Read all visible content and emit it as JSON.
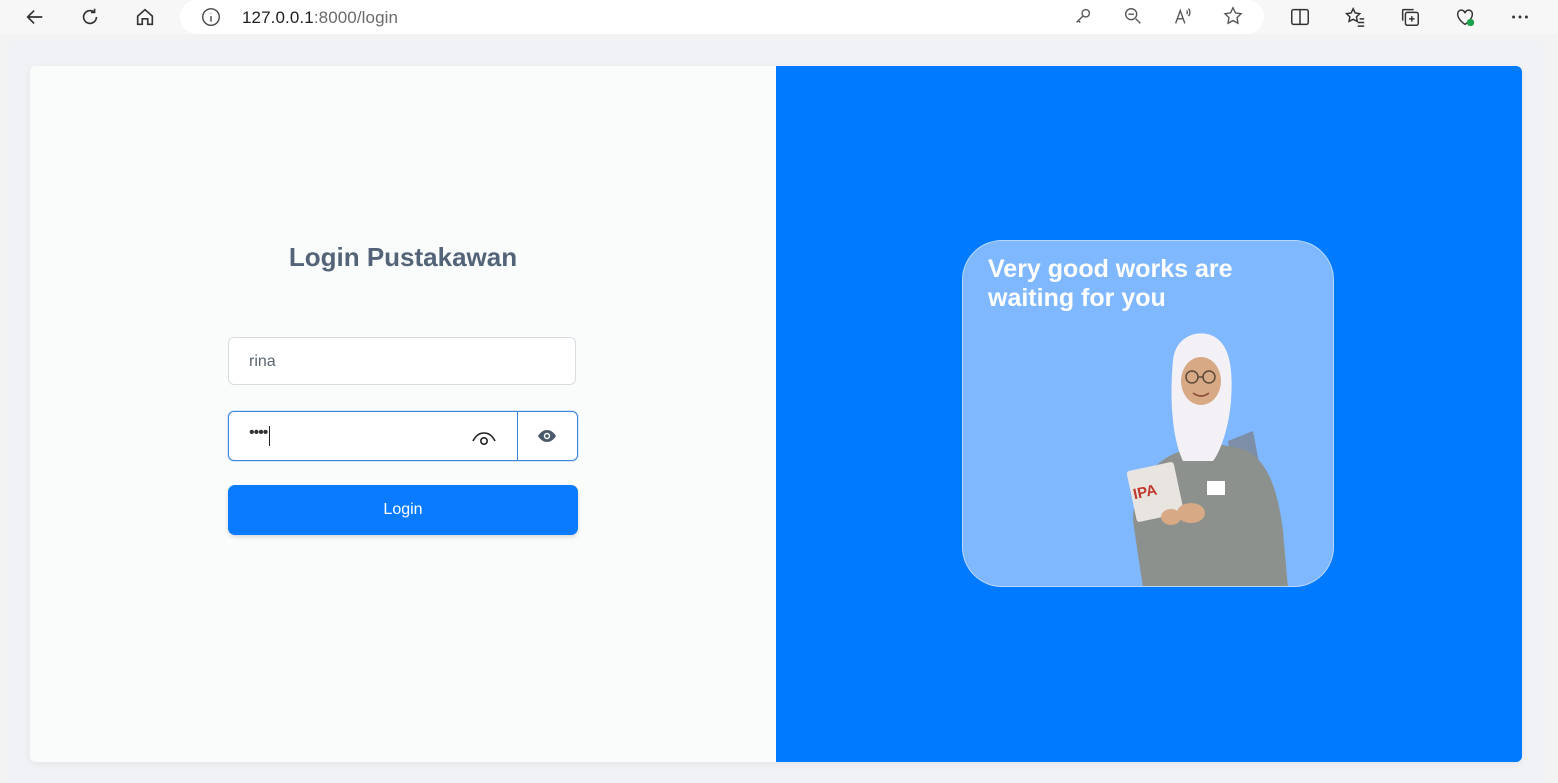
{
  "browser": {
    "url_host": "127.0.0.1",
    "url_rest": ":8000/login",
    "icons": [
      "back-icon",
      "refresh-icon",
      "home-icon",
      "info-icon",
      "key-icon",
      "zoom-out-icon",
      "read-aloud-icon",
      "favorite-star-icon",
      "split-screen-icon",
      "favorites-icon",
      "collections-icon",
      "browser-essentials-icon",
      "more-icon"
    ]
  },
  "login": {
    "title": "Login Pustakawan",
    "username_value": "rina",
    "password_value": "••••",
    "button_label": "Login"
  },
  "promo": {
    "headline": "Very good works are waiting for you",
    "book_label": "IPA"
  },
  "colors": {
    "primary": "#007bff",
    "promo_card": "#80b8ff",
    "title": "#536378"
  }
}
